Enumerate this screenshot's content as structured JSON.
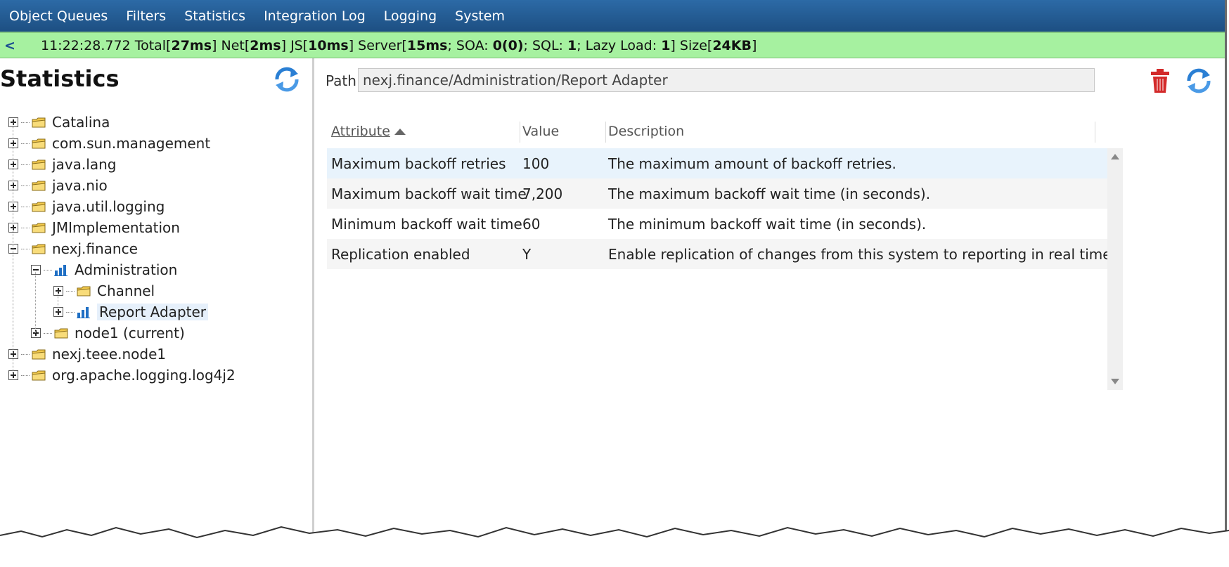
{
  "menubar": {
    "items": [
      "Object Queues",
      "Filters",
      "Statistics",
      "Integration Log",
      "Logging",
      "System"
    ]
  },
  "statusbar": {
    "back": "<",
    "time": "11:22:28.772",
    "total_label": "Total[",
    "total": "27ms",
    "total_close": "]",
    "net_label": " Net[",
    "net": "2ms",
    "net_close": "]",
    "js_label": " JS[",
    "js": "10ms",
    "js_close": "]",
    "server_label": " Server[",
    "server": "15ms",
    "soa_label": "; SOA: ",
    "soa": "0(0)",
    "sql_label": "; SQL: ",
    "sql": "1",
    "lazy_label": "; Lazy Load: ",
    "lazy": "1",
    "lazy_close": "]",
    "size_label": " Size[",
    "size": "24KB",
    "size_close": "]"
  },
  "left": {
    "title": "Statistics",
    "tree": [
      {
        "label": "Catalina",
        "depth": 0,
        "expander": "plus",
        "icon": "folder-icon"
      },
      {
        "label": "com.sun.management",
        "depth": 0,
        "expander": "plus",
        "icon": "folder-icon"
      },
      {
        "label": "java.lang",
        "depth": 0,
        "expander": "plus",
        "icon": "folder-icon"
      },
      {
        "label": "java.nio",
        "depth": 0,
        "expander": "plus",
        "icon": "folder-icon"
      },
      {
        "label": "java.util.logging",
        "depth": 0,
        "expander": "plus",
        "icon": "folder-icon"
      },
      {
        "label": "JMImplementation",
        "depth": 0,
        "expander": "plus",
        "icon": "folder-icon"
      },
      {
        "label": "nexj.finance",
        "depth": 0,
        "expander": "minus",
        "icon": "folder-icon"
      },
      {
        "label": "Administration",
        "depth": 1,
        "expander": "minus",
        "icon": "bar-chart-icon"
      },
      {
        "label": "Channel",
        "depth": 2,
        "expander": "plus",
        "icon": "folder-icon"
      },
      {
        "label": "Report Adapter",
        "depth": 2,
        "expander": "plus",
        "icon": "bar-chart-icon",
        "selected": true
      },
      {
        "label": "node1 (current)",
        "depth": 1,
        "expander": "plus",
        "icon": "folder-icon"
      },
      {
        "label": "nexj.teee.node1",
        "depth": 0,
        "expander": "plus",
        "icon": "folder-icon"
      },
      {
        "label": "org.apache.logging.log4j2",
        "depth": 0,
        "expander": "plus",
        "icon": "folder-icon"
      }
    ]
  },
  "right": {
    "path_label": "Path",
    "path_value": "nexj.finance/Administration/Report Adapter",
    "columns": {
      "attribute": "Attribute",
      "value": "Value",
      "description": "Description"
    },
    "rows": [
      {
        "attribute": "Maximum backoff retries",
        "value": "100",
        "description": "The maximum amount of backoff retries."
      },
      {
        "attribute": "Maximum backoff wait time",
        "value": "7,200",
        "description": "The maximum backoff wait time (in seconds)."
      },
      {
        "attribute": "Minimum backoff wait time",
        "value": "60",
        "description": "The minimum backoff wait time (in seconds)."
      },
      {
        "attribute": "Replication enabled",
        "value": "Y",
        "description": "Enable replication of changes from this system to reporting in real time."
      }
    ]
  },
  "colors": {
    "menubar": "#1d4f82",
    "statusbar": "#a6f1a0",
    "delete": "#d32a2a",
    "refresh": "#2a7fd4",
    "folder": "#f2c94c"
  }
}
